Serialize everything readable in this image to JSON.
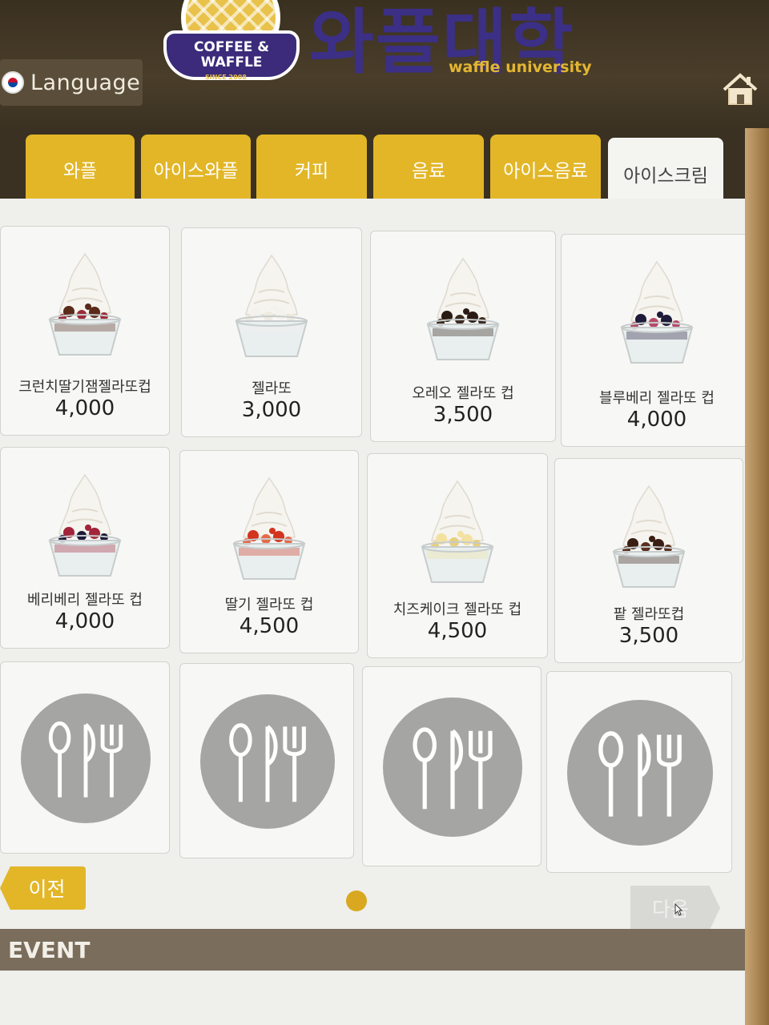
{
  "header": {
    "language_label": "Language",
    "logo_line1": "COFFEE &",
    "logo_line2": "WAFFLE",
    "logo_since": "SINCE 2008",
    "brand_korean": "와플대학",
    "brand_english": "waffle university"
  },
  "tabs": [
    {
      "label": "와플",
      "active": false
    },
    {
      "label": "아이스와플",
      "active": false
    },
    {
      "label": "커피",
      "active": false
    },
    {
      "label": "음료",
      "active": false
    },
    {
      "label": "아이스음료",
      "active": false
    },
    {
      "label": "아이스크림",
      "active": true
    }
  ],
  "products": [
    {
      "name": "크런치딸기잼젤라또컵",
      "price": "4,000",
      "topping": "choco-berry"
    },
    {
      "name": "젤라또",
      "price": "3,000",
      "topping": "plain"
    },
    {
      "name": "오레오 젤라또 컵",
      "price": "3,500",
      "topping": "oreo"
    },
    {
      "name": "블루베리 젤라또 컵",
      "price": "4,000",
      "topping": "blueberry"
    },
    {
      "name": "베리베리 젤라또 컵",
      "price": "4,000",
      "topping": "mixed-berry"
    },
    {
      "name": "딸기 젤라또 컵",
      "price": "4,500",
      "topping": "strawberry"
    },
    {
      "name": "치즈케이크 젤라또 컵",
      "price": "4,500",
      "topping": "cheesecake"
    },
    {
      "name": "팥 젤라또컵",
      "price": "3,500",
      "topping": "red-bean"
    }
  ],
  "empty_slots": 4,
  "pager": {
    "prev_label": "이전",
    "next_label": "다음",
    "current_page": 1
  },
  "event": {
    "label": "EVENT"
  },
  "colors": {
    "accent": "#e2b627",
    "brand_purple": "#3b2f86",
    "panel": "#efefec"
  }
}
